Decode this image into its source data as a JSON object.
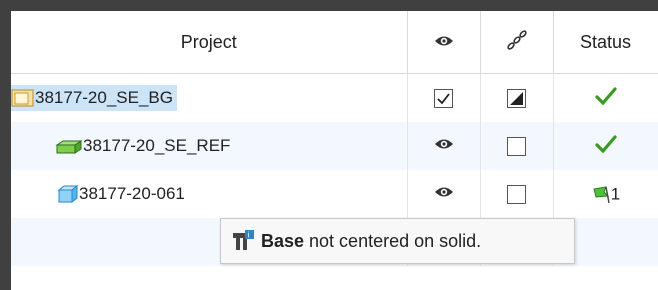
{
  "columns": {
    "project": "Project",
    "status": "Status"
  },
  "icons": {
    "visibility": "eye-icon",
    "link": "chain-link-icon",
    "status_ok": "check-icon",
    "status_flag": "flag-icon",
    "tooltip": "base-icon"
  },
  "colors": {
    "selection": "#cce4f7",
    "check_green": "#3a9a1e",
    "alt_row": "#f2f8fd"
  },
  "rows": [
    {
      "name": "38177-20_SE_BG",
      "status_count": ""
    },
    {
      "name": "38177-20_SE_REF",
      "status_count": ""
    },
    {
      "name": "38177-20-061",
      "status_count": "1"
    }
  ],
  "tooltip": {
    "bold": "Base",
    "rest": " not centered on solid."
  }
}
